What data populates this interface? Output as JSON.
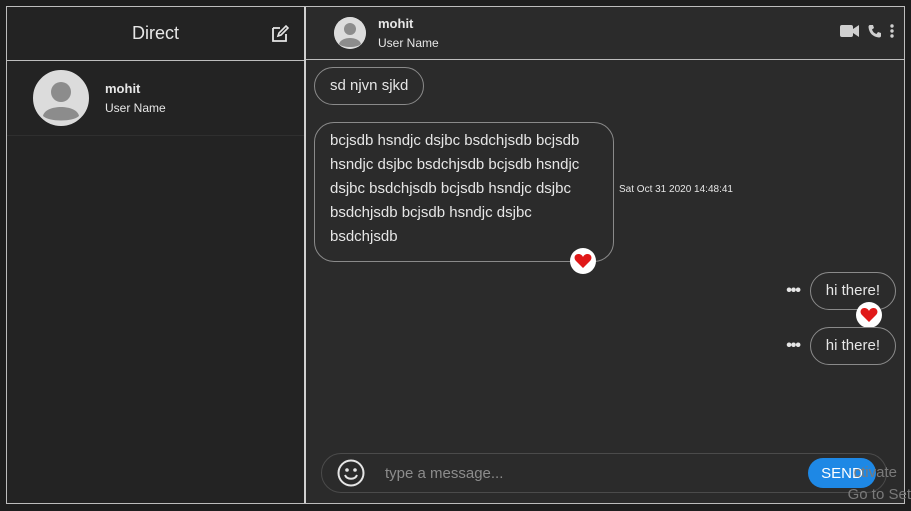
{
  "sidebar": {
    "title": "Direct",
    "contacts": [
      {
        "name": "mohit",
        "subtitle": "User Name"
      }
    ]
  },
  "chat": {
    "header": {
      "name": "mohit",
      "subtitle": "User Name"
    },
    "messages": [
      {
        "side": "left",
        "text": "sd njvn sjkd"
      },
      {
        "side": "left",
        "text": "bcjsdb hsndjc dsjbc bsdchjsdb bcjsdb hsndjc dsjbc bsdchjsdb bcjsdb hsndjc dsjbc bsdchjsdb bcjsdb hsndjc dsjbc bsdchjsdb bcjsdb hsndjc dsjbc bsdchjsdb",
        "timestamp": "Sat Oct 31 2020 14:48:41",
        "liked": true
      },
      {
        "side": "right",
        "text": "hi there!",
        "liked": true
      },
      {
        "side": "right",
        "text": "hi there!"
      }
    ],
    "more_glyph": "•••"
  },
  "composer": {
    "placeholder": "type a message...",
    "send_label": "SEND"
  },
  "watermark": {
    "line1": "ctivate",
    "line2": "Go to Set"
  },
  "icons": {
    "compose": "edit-icon",
    "video": "video-camera-icon",
    "phone": "phone-icon",
    "more": "kebab-menu-icon",
    "emoji": "smiley-icon",
    "heart": "heart-icon"
  },
  "colors": {
    "background": "#2b2b2b",
    "sidebar": "#232323",
    "accent": "#1e88e5",
    "heart": "#e01818"
  }
}
